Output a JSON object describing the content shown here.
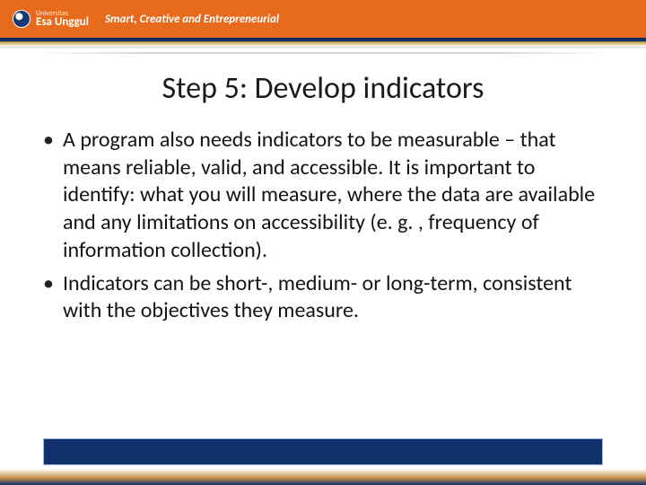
{
  "header": {
    "logo_small": "Universitas",
    "logo_name": "Esa Unggul",
    "tagline": "Smart, Creative and Entrepreneurial"
  },
  "slide": {
    "title": "Step 5: Develop indicators",
    "bullets": [
      "A program also needs indicators to be measurable – that means reliable, valid, and accessible. It is important to identify: what you will measure, where the data are available and any limitations on accessibility (e. g. , frequency of information collection).",
      "Indicators can be short-, medium- or long-term, consistent with the objectives they measure."
    ]
  },
  "colors": {
    "accent_orange": "#e86a1c",
    "brand_navy": "#10316b"
  }
}
